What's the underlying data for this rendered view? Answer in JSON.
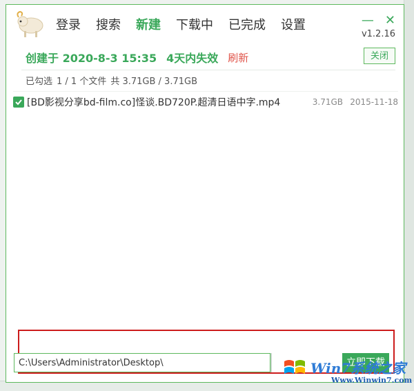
{
  "nav": {
    "items": [
      {
        "label": "登录",
        "active": false
      },
      {
        "label": "搜索",
        "active": false
      },
      {
        "label": "新建",
        "active": true
      },
      {
        "label": "下载中",
        "active": false
      },
      {
        "label": "已完成",
        "active": false
      },
      {
        "label": "设置",
        "active": false
      }
    ]
  },
  "window": {
    "minimize_label": "—",
    "close_label": "✕",
    "version": "v1.2.16"
  },
  "task": {
    "created_text": "创建于 2020-8-3 15:35",
    "expire_text": "4天内失效",
    "refresh_label": "刷新",
    "close_label": "关闭"
  },
  "selection": {
    "selected_label": "已勾选",
    "count_text": "1 / 1 个文件",
    "size_text": "共 3.71GB / 3.71GB"
  },
  "files": [
    {
      "name": "[BD影视分享bd-film.co]怪谈.BD720P.超清日语中字.mp4",
      "size": "3.71GB",
      "date": "2015-11-18",
      "checked": true
    }
  ],
  "bottom": {
    "path_value": "C:\\Users\\Administrator\\Desktop\\",
    "start_label": "立即下载"
  },
  "watermark": {
    "text": "Win7系统之家",
    "url": "Www.Winwin7.com"
  },
  "colors": {
    "accent": "#3aa85a",
    "refresh": "#e0544a",
    "highlight": "#cc1b1b"
  },
  "icons": {
    "logo": "sheep-logo-icon",
    "checkbox": "checkmark-icon",
    "watermark_logo": "windows-logo-icon"
  }
}
